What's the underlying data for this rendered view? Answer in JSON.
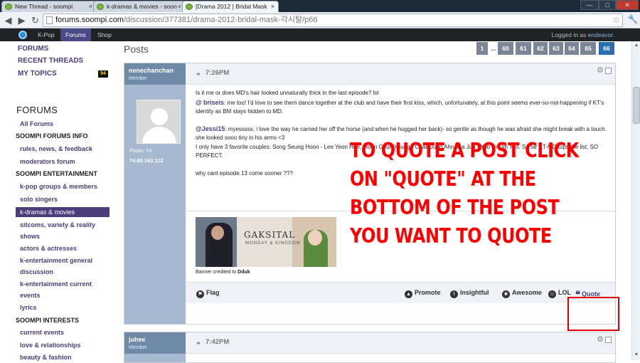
{
  "browser": {
    "tabs": [
      {
        "title": "New Thread - soompi",
        "active": false
      },
      {
        "title": "k-dramas & movies - soon",
        "active": false
      },
      {
        "title": "[Drama 2012 ] Bridal Mask",
        "active": true
      }
    ],
    "tab_close_glyph": "×",
    "address": {
      "domain": "forums.soompi.com",
      "path": "/discussion/377381/drama-2012-bridal-mask-각시탈/p66"
    },
    "window_controls": [
      "—",
      "□",
      "✕"
    ]
  },
  "site_nav": {
    "links": [
      {
        "label": "K-Pop",
        "active": false
      },
      {
        "label": "Forums",
        "active": true
      },
      {
        "label": "Shop",
        "active": false
      }
    ],
    "logged_in_prefix": "Logged in as",
    "username": "endeavor."
  },
  "sidebar": {
    "top_links": [
      "FORUMS",
      "RECENT THREADS",
      "MY TOPICS"
    ],
    "my_topics_count": "94",
    "forums_heading": "FORUMS",
    "rows": [
      {
        "label": "All Forums",
        "kind": "link"
      },
      {
        "label": "SOOMPI FORUMS INFO",
        "kind": "cat"
      },
      {
        "label": "rules, news, & feedback",
        "kind": "link"
      },
      {
        "label": "moderators forum",
        "kind": "link"
      },
      {
        "label": "SOOMPI ENTERTAINMENT",
        "kind": "cat"
      },
      {
        "label": "k-pop groups & members",
        "kind": "link"
      },
      {
        "label": "solo singers",
        "kind": "link"
      },
      {
        "label": "k-dramas & movies",
        "kind": "sel"
      },
      {
        "label": "sitcoms, variety & reality",
        "kind": "link"
      },
      {
        "label": "shows",
        "kind": "link"
      },
      {
        "label": "actors & actresses",
        "kind": "link"
      },
      {
        "label": "k-entertainment general",
        "kind": "link"
      },
      {
        "label": "discussion",
        "kind": "link"
      },
      {
        "label": "k-entertainment current",
        "kind": "link"
      },
      {
        "label": "events",
        "kind": "link"
      },
      {
        "label": "lyrics",
        "kind": "link"
      },
      {
        "label": "SOOMPI INTERESTS",
        "kind": "cat"
      },
      {
        "label": "current events",
        "kind": "link"
      },
      {
        "label": "love & relationships",
        "kind": "link"
      },
      {
        "label": "beauty & fashion",
        "kind": "link"
      }
    ]
  },
  "main": {
    "title": "Posts",
    "pager": [
      {
        "label": "1",
        "current": false
      },
      {
        "label": "...",
        "current": false,
        "dots": true
      },
      {
        "label": "60",
        "current": false
      },
      {
        "label": "61",
        "current": false
      },
      {
        "label": "62",
        "current": false
      },
      {
        "label": "63",
        "current": false
      },
      {
        "label": "64",
        "current": false
      },
      {
        "label": "65",
        "current": false
      },
      {
        "label": "66",
        "current": true
      }
    ]
  },
  "post1": {
    "author": "nenechanchan",
    "rank": "Member",
    "posts": "Posts: 74",
    "ip": "74.60.163.112",
    "time": "7:26PM",
    "line1": "Is it me or does MD's hair looked unnaturally thick in the last episode? lol",
    "m1_at": "@",
    "m1_name": "briseis",
    "m1_text": ": me too! I'd love to see them dance together at the club and have their first kiss, which, unfortunately, at this point seems ever-so-not-happening if KT's identity as BM stays hidden to MD.",
    "m2_at": "@",
    "m2_name": "Jessi15",
    "m2_text": ": myesssss, i love the way he carried her off the horse (and when he hugged her back)- so gentle as though he was afraid she might break with a touch. she looked sooo tiny in his arms <3",
    "line4": "I only have 3 favorite couples: Song Seung Hoon - Lee Yeon Hee, Moon Geun Young - Chae Jung Ahn, Ga Jun - Yoo Jin Jin Yoo. So far KT-MD tops the list. SO PERFECT.",
    "line5": "why cant episode 13 come sooner ???",
    "banner_title": "GAKSITAL",
    "banner_sub": "MONDAY & KINGDOM",
    "credit_prefix": "Banner credited to",
    "credit_name": "Dduk",
    "actions": {
      "flag": "Flag",
      "promote": "Promote",
      "insightful": "Insightful",
      "awesome": "Awesome",
      "lol": "LOL",
      "quote": "Quote"
    }
  },
  "post2": {
    "author": "juhee",
    "rank": "Member",
    "time": "7:42PM"
  },
  "annotation": {
    "lines": [
      "TO QUOTE A POST CLICK",
      "ON \"QUOTE\" AT THE",
      "BOTTOM OF THE POST",
      "YOU WANT TO QUOTE"
    ],
    "color": "#ff0000"
  },
  "colors": {
    "accent": "#4b3c7a",
    "author_panel": "#6e8aa6",
    "pager_current": "#2c6fb1",
    "highlight": "#e00000"
  }
}
